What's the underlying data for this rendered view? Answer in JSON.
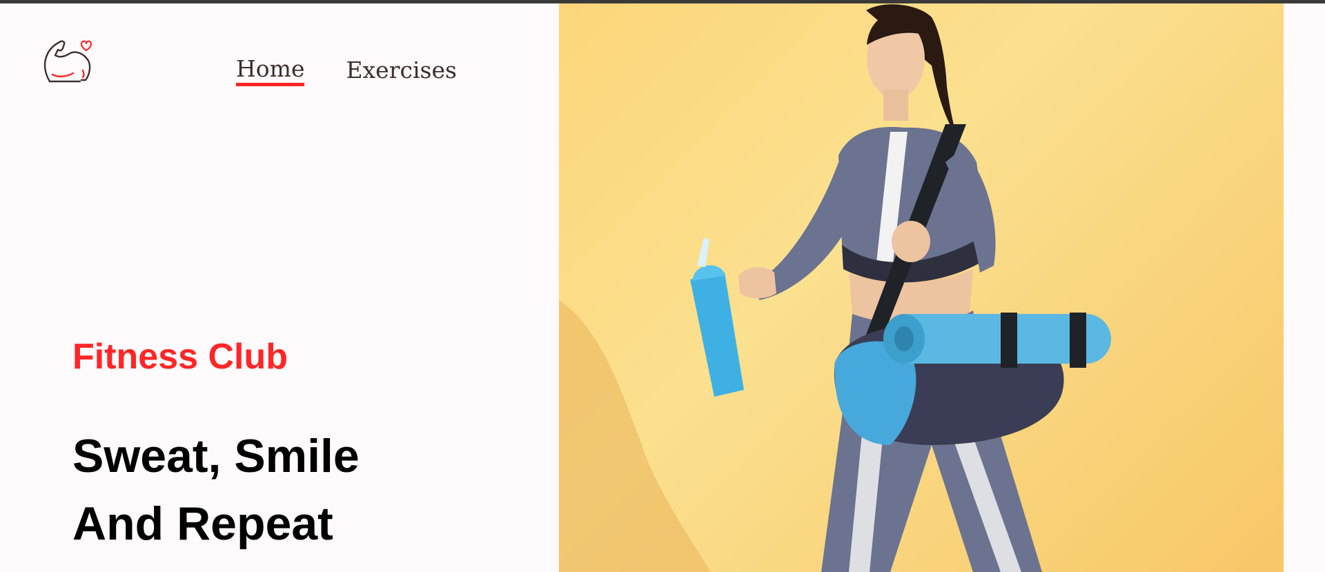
{
  "brand": {
    "logo_icon": "flexed-arm-heart-icon",
    "accent_color": "#ff2625"
  },
  "nav": {
    "items": [
      {
        "label": "Home",
        "active": true
      },
      {
        "label": "Exercises",
        "active": false
      }
    ]
  },
  "hero": {
    "tagline": "Fitness Club",
    "headline_line1": "Sweat, Smile",
    "headline_line2": "And Repeat",
    "image_icon": "woman-with-yoga-mat-and-shaker-photo",
    "image_background_color": "#fcd985"
  }
}
